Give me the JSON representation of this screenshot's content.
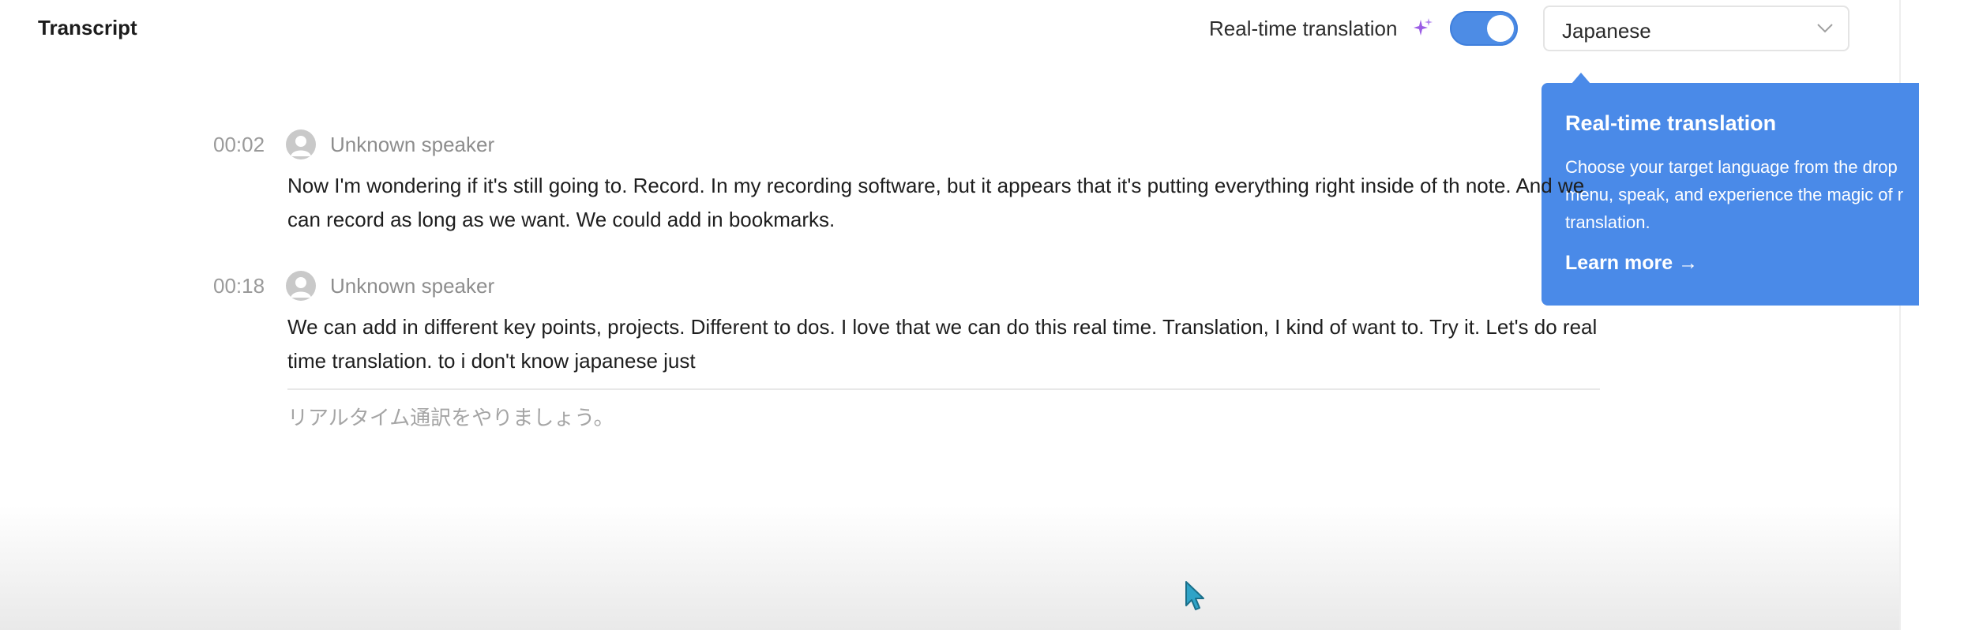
{
  "header": {
    "title": "Transcript",
    "realtime_label": "Real-time translation",
    "toggle_on": true
  },
  "language_select": {
    "value": "Japanese",
    "chevron_icon": "chevron-down-icon"
  },
  "tooltip": {
    "title": "Real-time translation",
    "body_line1": "Choose your target language from the drop",
    "body_line2": "menu, speak, and experience the magic of r",
    "body_line3": "translation.",
    "link_label": "Learn more →",
    "background": "#4a8ae8"
  },
  "segments": [
    {
      "time": "00:02",
      "speaker": "Unknown speaker",
      "text": "Now I'm wondering if it's still going to. Record. In my recording software, but it appears that it's putting everything right inside of th note. And we can record as long as we want. We could add in bookmarks."
    },
    {
      "time": "00:18",
      "speaker": "Unknown speaker",
      "text": "We can add in different key points, projects. Different to dos. I love that we can do this real time. Translation, I kind of want to. Try it. Let's do real time translation. to i don't know japanese just"
    }
  ],
  "translation": {
    "text": "リアルタイム通訳をやりましょう。"
  },
  "colors": {
    "accent": "#4d8ce5",
    "sparkle": "#9b5de5"
  }
}
